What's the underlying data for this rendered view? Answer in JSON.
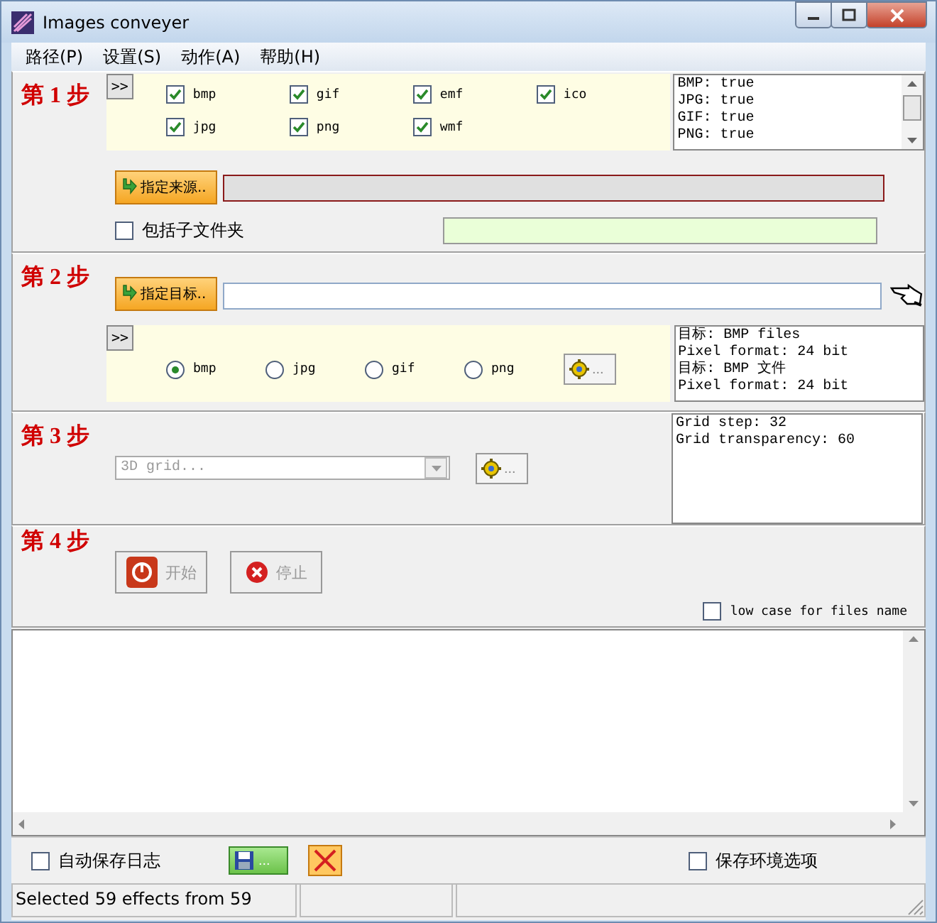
{
  "window": {
    "title": "Images conveyer"
  },
  "menu": [
    {
      "label": "路径(P)"
    },
    {
      "label": "设置(S)"
    },
    {
      "label": "动作(A)"
    },
    {
      "label": "帮助(H)"
    }
  ],
  "step1": {
    "label": "第 1 步",
    "expand_button": ">>",
    "formats": [
      {
        "label": "bmp",
        "checked": true
      },
      {
        "label": "gif",
        "checked": true
      },
      {
        "label": "emf",
        "checked": true
      },
      {
        "label": "ico",
        "checked": true
      },
      {
        "label": "jpg",
        "checked": true
      },
      {
        "label": "png",
        "checked": true
      },
      {
        "label": "wmf",
        "checked": true
      }
    ],
    "info_lines": [
      "BMP: true",
      "JPG: true",
      "GIF: true",
      "PNG: true"
    ],
    "source_button": "指定来源..",
    "subfolders": {
      "label": "包括子文件夹",
      "checked": false
    }
  },
  "step2": {
    "label": "第 2 步",
    "target_button": "指定目标..",
    "expand_button": ">>",
    "formats": [
      {
        "label": "bmp",
        "selected": true
      },
      {
        "label": "jpg",
        "selected": false
      },
      {
        "label": "gif",
        "selected": false
      },
      {
        "label": "png",
        "selected": false
      }
    ],
    "settings_button": "...",
    "info_lines": [
      "目标: BMP files",
      "Pixel format: 24 bit",
      "目标: BMP 文件",
      "Pixel format: 24 bit"
    ]
  },
  "step3": {
    "label": "第 3 步",
    "effect": {
      "value": "3D grid...",
      "disabled": true
    },
    "settings_button": "...",
    "info_lines": [
      "Grid step: 32",
      "Grid transparency: 60"
    ]
  },
  "step4": {
    "label": "第 4 步",
    "buttons": [
      {
        "kind": "start",
        "label": "开始",
        "disabled": true
      },
      {
        "kind": "stop",
        "label": "停止",
        "disabled": true
      }
    ],
    "lowcase": {
      "label": "low case for files name",
      "checked": false
    }
  },
  "bottom": {
    "autosave": {
      "label": "自动保存日志",
      "checked": false
    },
    "save_button": "...",
    "saveenv": {
      "label": "保存环境选项",
      "checked": false
    }
  },
  "status_bar": {
    "text": "Selected 59 effects from 59"
  }
}
